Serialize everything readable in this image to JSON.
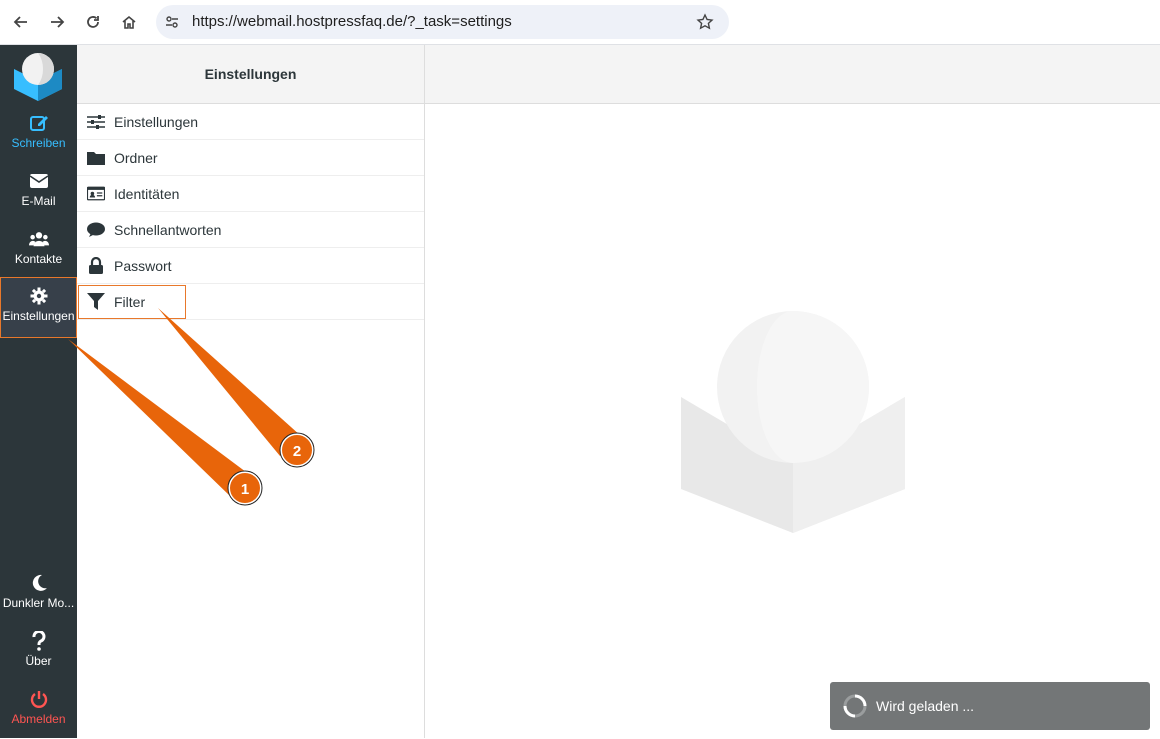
{
  "browser": {
    "url": "https://webmail.hostpressfaq.de/?_task=settings",
    "icons": [
      "back-icon",
      "forward-icon",
      "reload-icon",
      "home-icon",
      "site-settings-icon",
      "bookmark-star-icon"
    ]
  },
  "rail": {
    "items": [
      {
        "label": "Schreiben",
        "icon": "compose-icon"
      },
      {
        "label": "E-Mail",
        "icon": "envelope-icon"
      },
      {
        "label": "Kontakte",
        "icon": "users-icon"
      },
      {
        "label": "Einstellungen",
        "icon": "gear-icon"
      }
    ],
    "bottom_items": [
      {
        "label": "Dunkler Mo...",
        "icon": "moon-icon"
      },
      {
        "label": "Über",
        "icon": "question-icon"
      },
      {
        "label": "Abmelden",
        "icon": "power-icon"
      }
    ]
  },
  "settings_panel": {
    "title": "Einstellungen",
    "items": [
      {
        "label": "Einstellungen",
        "icon": "sliders-icon"
      },
      {
        "label": "Ordner",
        "icon": "folder-icon"
      },
      {
        "label": "Identitäten",
        "icon": "id-card-icon"
      },
      {
        "label": "Schnellantworten",
        "icon": "comment-icon"
      },
      {
        "label": "Passwort",
        "icon": "lock-icon"
      },
      {
        "label": "Filter",
        "icon": "filter-icon"
      }
    ]
  },
  "toast": {
    "text": "Wird geladen ..."
  },
  "annotations": {
    "badges": [
      "1",
      "2"
    ]
  },
  "colors": {
    "accent": "#37beff",
    "highlight": "#e8782b",
    "callout": "#e8650a",
    "rail_bg": "#2c363a",
    "logout": "#ff5552"
  }
}
